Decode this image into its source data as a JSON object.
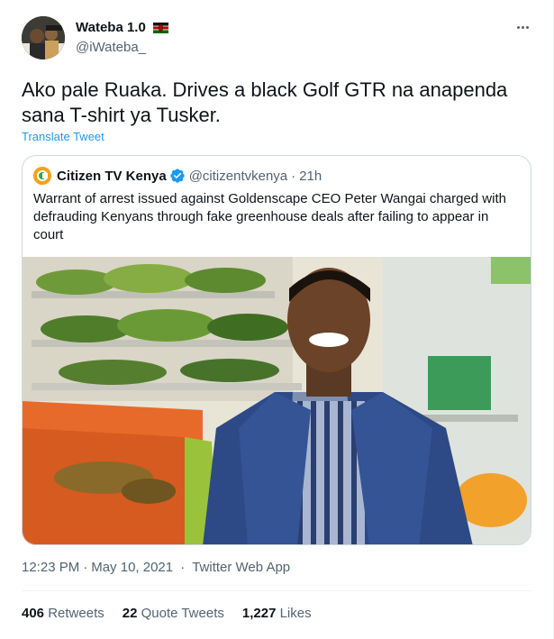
{
  "tweet": {
    "author": {
      "display_name": "Wateba 1.0",
      "handle": "@iWateba_",
      "flag_icon": "kenya-flag-icon"
    },
    "text": "Ako pale Ruaka. Drives a black Golf GTR na anapenda sana T-shirt ya Tusker.",
    "translate_label": "Translate Tweet",
    "quoted": {
      "display_name": "Citizen TV Kenya",
      "handle": "@citizentvkenya",
      "separator": "·",
      "time": "21h",
      "text": "Warrant of arrest issued against Goldenscape CEO Peter Wangai charged with defrauding Kenyans through fake greenhouse deals after failing to appear in court",
      "verified": true
    },
    "meta": {
      "time": "12:23 PM",
      "separator": "·",
      "date": "May 10, 2021",
      "source": "Twitter Web App"
    },
    "stats": [
      {
        "count": "406",
        "label": "Retweets"
      },
      {
        "count": "22",
        "label": "Quote Tweets"
      },
      {
        "count": "1,227",
        "label": "Likes"
      }
    ]
  },
  "colors": {
    "accent": "#1d9bf0",
    "secondary_text": "#536471",
    "border": "#cfd9de",
    "citizen_logo": "#f4a11d"
  }
}
